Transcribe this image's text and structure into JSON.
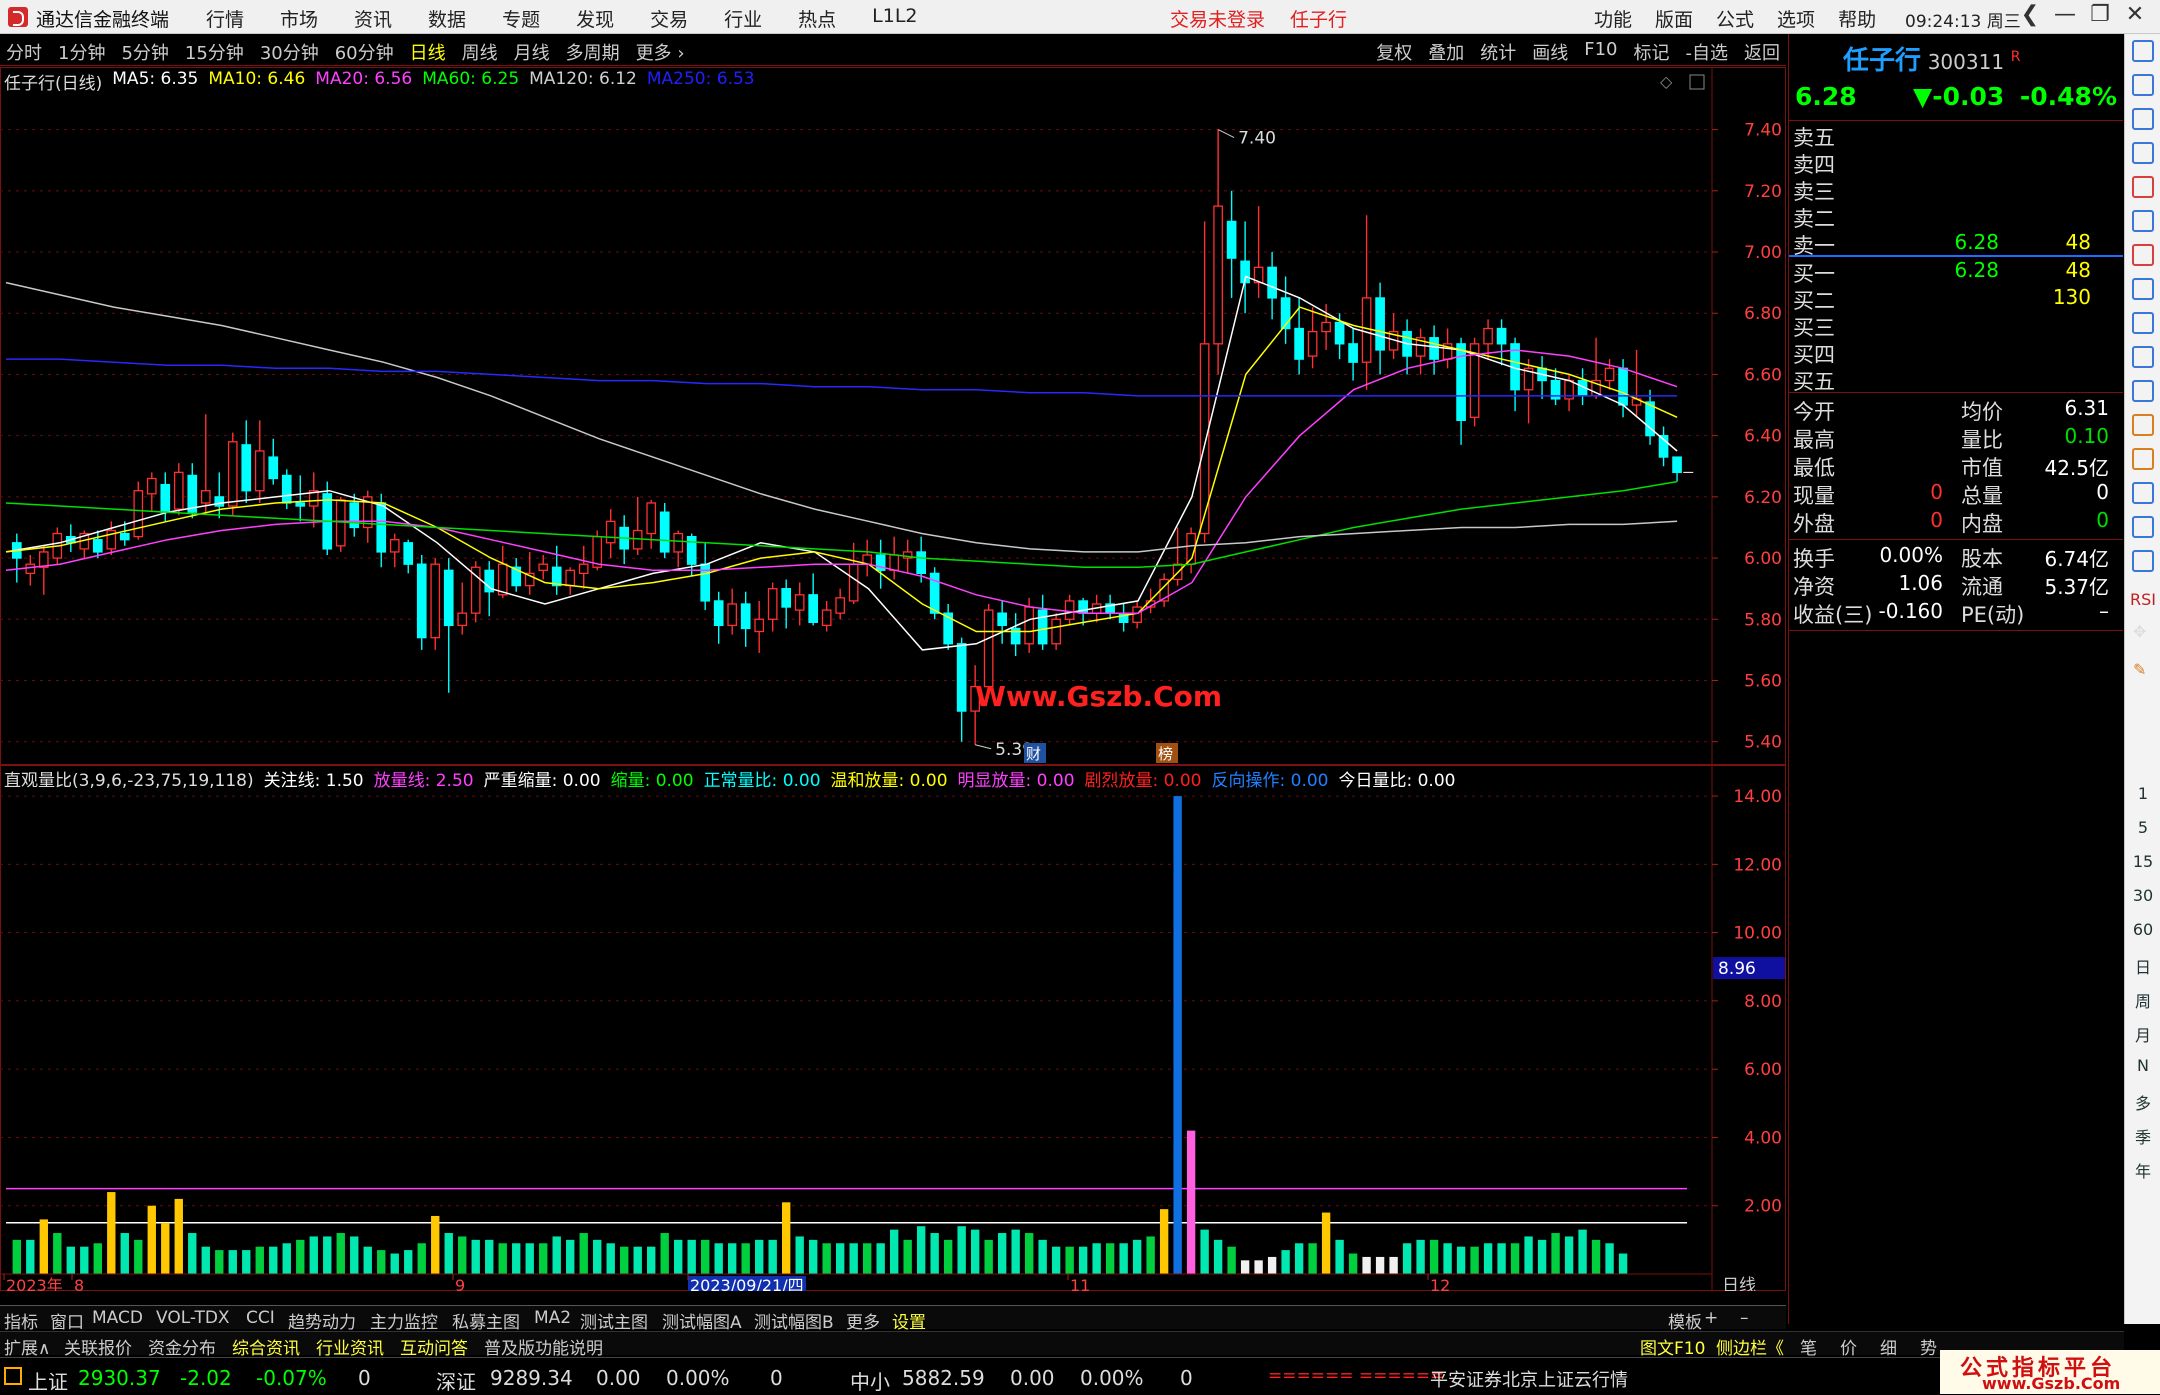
{
  "titlebar": {
    "app_title": "通达信金融终端",
    "menu": [
      "行情",
      "市场",
      "资讯",
      "数据",
      "专题",
      "发现",
      "交易",
      "行业",
      "热点",
      "L1L2"
    ],
    "notice": "交易未登录",
    "stock_name": "任子行",
    "right_menu": [
      "功能",
      "版面",
      "公式",
      "选项",
      "帮助"
    ],
    "time": "09:24:13",
    "weekday": "周三",
    "nav_back": "❮",
    "minimize": "—",
    "restore": "❐",
    "close": "✕"
  },
  "period_bar": {
    "left": [
      "分时",
      "1分钟",
      "5分钟",
      "15分钟",
      "30分钟",
      "60分钟",
      "日线",
      "周线",
      "月线",
      "多周期",
      "更多 ›"
    ],
    "active": "日线",
    "right": [
      "复权",
      "叠加",
      "统计",
      "画线",
      "F10",
      "标记",
      "-自选",
      "返回"
    ]
  },
  "ma_line": {
    "title": "任子行(日线)",
    "items": [
      {
        "label": "MA5: 6.35",
        "color": "#ffffff"
      },
      {
        "label": "MA10: 6.46",
        "color": "#ffff00"
      },
      {
        "label": "MA20: 6.56",
        "color": "#ff40ff"
      },
      {
        "label": "MA60: 6.25",
        "color": "#00ff00"
      },
      {
        "label": "MA120: 6.12",
        "color": "#d0d0d0"
      },
      {
        "label": "MA250: 6.53",
        "color": "#2020ff"
      }
    ]
  },
  "price_axis": [
    "7.40",
    "7.20",
    "7.00",
    "6.80",
    "6.60",
    "6.40",
    "6.20",
    "6.00",
    "5.80",
    "5.60",
    "5.40"
  ],
  "annotations": {
    "high": "7.40",
    "low": "5.39",
    "watermark": "Www.Gszb.Com",
    "tag_cai": "财",
    "tag_bang": "榜"
  },
  "indicator_line": {
    "items": [
      {
        "label": "直观量比(3,9,6,-23,75,19,118)",
        "color": "#dddddd"
      },
      {
        "label": "关注线: 1.50",
        "color": "#ffffff"
      },
      {
        "label": "放量线: 2.50",
        "color": "#ff40ff"
      },
      {
        "label": "严重缩量: 0.00",
        "color": "#ffffff"
      },
      {
        "label": "缩量: 0.00",
        "color": "#00ff00"
      },
      {
        "label": "正常量比: 0.00",
        "color": "#00ffff"
      },
      {
        "label": "温和放量: 0.00",
        "color": "#ffff00"
      },
      {
        "label": "明显放量: 0.00",
        "color": "#ff40ff"
      },
      {
        "label": "剧烈放量: 0.00",
        "color": "#ff2020"
      },
      {
        "label": "反向操作: 0.00",
        "color": "#2080ff"
      },
      {
        "label": "今日量比: 0.00",
        "color": "#ffffff"
      }
    ]
  },
  "indicator_axis": [
    "14.00",
    "12.00",
    "10.00",
    "8.00",
    "6.00",
    "4.00",
    "2.00"
  ],
  "indicator_marker": "8.96",
  "date_axis": {
    "labels": [
      "2023年",
      "8",
      "9",
      "2023/09/21/四",
      "11",
      "12"
    ],
    "period": "日线"
  },
  "chart_data": {
    "type": "candlestick",
    "title": "任子行(日线)",
    "price_range": [
      5.35,
      7.5
    ],
    "ma_values": {
      "MA5": 6.35,
      "MA10": 6.46,
      "MA20": 6.56,
      "MA60": 6.25,
      "MA120": 6.12,
      "MA250": 6.53
    },
    "candles": [
      [
        6.05,
        6.0,
        6.08,
        5.92
      ],
      [
        5.95,
        5.98,
        6.01,
        5.91
      ],
      [
        5.97,
        6.02,
        6.04,
        5.88
      ],
      [
        6.0,
        6.08,
        6.1,
        5.98
      ],
      [
        6.07,
        6.05,
        6.11,
        6.02
      ],
      [
        6.03,
        6.08,
        6.09,
        6.0
      ],
      [
        6.06,
        6.02,
        6.09,
        6.0
      ],
      [
        6.03,
        6.09,
        6.12,
        6.01
      ],
      [
        6.08,
        6.06,
        6.12,
        6.04
      ],
      [
        6.07,
        6.22,
        6.25,
        6.06
      ],
      [
        6.21,
        6.26,
        6.28,
        6.15
      ],
      [
        6.24,
        6.15,
        6.28,
        6.12
      ],
      [
        6.16,
        6.28,
        6.31,
        6.14
      ],
      [
        6.27,
        6.15,
        6.31,
        6.13
      ],
      [
        6.18,
        6.22,
        6.47,
        6.15
      ],
      [
        6.2,
        6.17,
        6.28,
        6.13
      ],
      [
        6.17,
        6.38,
        6.41,
        6.14
      ],
      [
        6.37,
        6.22,
        6.45,
        6.18
      ],
      [
        6.22,
        6.35,
        6.45,
        6.18
      ],
      [
        6.33,
        6.26,
        6.39,
        6.24
      ],
      [
        6.27,
        6.18,
        6.29,
        6.16
      ],
      [
        6.18,
        6.17,
        6.27,
        6.12
      ],
      [
        6.17,
        6.22,
        6.28,
        6.1
      ],
      [
        6.21,
        6.03,
        6.25,
        6.01
      ],
      [
        6.04,
        6.19,
        6.2,
        6.02
      ],
      [
        6.18,
        6.1,
        6.21,
        6.07
      ],
      [
        6.1,
        6.2,
        6.22,
        6.05
      ],
      [
        6.18,
        6.02,
        6.21,
        5.97
      ],
      [
        6.02,
        6.06,
        6.08,
        5.97
      ],
      [
        6.05,
        5.98,
        6.06,
        5.95
      ],
      [
        5.98,
        5.74,
        6.01,
        5.7
      ],
      [
        5.74,
        5.98,
        6.0,
        5.7
      ],
      [
        5.96,
        5.78,
        6.0,
        5.56
      ],
      [
        5.78,
        5.82,
        5.92,
        5.75
      ],
      [
        5.82,
        5.97,
        5.99,
        5.79
      ],
      [
        5.96,
        5.89,
        5.99,
        5.81
      ],
      [
        5.88,
        5.98,
        6.04,
        5.87
      ],
      [
        5.97,
        5.91,
        6.0,
        5.89
      ],
      [
        5.91,
        5.95,
        6.02,
        5.88
      ],
      [
        5.96,
        5.98,
        6.01,
        5.93
      ],
      [
        5.97,
        5.91,
        6.04,
        5.88
      ],
      [
        5.91,
        5.96,
        5.97,
        5.88
      ],
      [
        5.95,
        5.98,
        6.04,
        5.9
      ],
      [
        5.97,
        6.07,
        6.09,
        5.96
      ],
      [
        6.05,
        6.12,
        6.16,
        6.0
      ],
      [
        6.1,
        6.03,
        6.14,
        5.98
      ],
      [
        6.03,
        6.09,
        6.2,
        6.01
      ],
      [
        6.08,
        6.18,
        6.19,
        6.03
      ],
      [
        6.15,
        6.02,
        6.18,
        6.0
      ],
      [
        6.02,
        6.08,
        6.09,
        5.97
      ],
      [
        6.07,
        5.98,
        6.08,
        5.94
      ],
      [
        5.98,
        5.86,
        6.05,
        5.83
      ],
      [
        5.86,
        5.78,
        5.89,
        5.72
      ],
      [
        5.78,
        5.85,
        5.9,
        5.75
      ],
      [
        5.85,
        5.77,
        5.89,
        5.71
      ],
      [
        5.76,
        5.8,
        5.86,
        5.69
      ],
      [
        5.8,
        5.9,
        5.92,
        5.76
      ],
      [
        5.9,
        5.84,
        5.93,
        5.77
      ],
      [
        5.83,
        5.88,
        5.92,
        5.78
      ],
      [
        5.88,
        5.79,
        5.95,
        5.78
      ],
      [
        5.78,
        5.83,
        5.86,
        5.76
      ],
      [
        5.82,
        5.87,
        5.9,
        5.8
      ],
      [
        5.86,
        5.98,
        6.05,
        5.85
      ],
      [
        5.98,
        6.01,
        6.06,
        5.94
      ],
      [
        6.01,
        5.96,
        6.06,
        5.9
      ],
      [
        5.96,
        6.01,
        6.07,
        5.93
      ],
      [
        6.0,
        6.02,
        6.06,
        5.95
      ],
      [
        6.02,
        5.95,
        6.07,
        5.92
      ],
      [
        5.95,
        5.82,
        5.97,
        5.8
      ],
      [
        5.82,
        5.72,
        5.85,
        5.7
      ],
      [
        5.72,
        5.5,
        5.74,
        5.4
      ],
      [
        5.5,
        5.58,
        5.65,
        5.39
      ],
      [
        5.58,
        5.83,
        5.85,
        5.56
      ],
      [
        5.82,
        5.78,
        5.86,
        5.72
      ],
      [
        5.77,
        5.72,
        5.82,
        5.68
      ],
      [
        5.72,
        5.84,
        5.87,
        5.69
      ],
      [
        5.83,
        5.72,
        5.88,
        5.7
      ],
      [
        5.72,
        5.8,
        5.82,
        5.7
      ],
      [
        5.8,
        5.86,
        5.88,
        5.78
      ],
      [
        5.86,
        5.82,
        5.87,
        5.78
      ],
      [
        5.82,
        5.85,
        5.88,
        5.79
      ],
      [
        5.85,
        5.82,
        5.88,
        5.8
      ],
      [
        5.82,
        5.79,
        5.85,
        5.76
      ],
      [
        5.79,
        5.84,
        5.86,
        5.77
      ],
      [
        5.84,
        5.86,
        5.9,
        5.82
      ],
      [
        5.86,
        5.93,
        5.95,
        5.84
      ],
      [
        5.93,
        5.98,
        6.1,
        5.91
      ],
      [
        5.98,
        6.08,
        6.1,
        5.95
      ],
      [
        6.08,
        6.7,
        7.1,
        6.05
      ],
      [
        6.7,
        7.15,
        7.4,
        6.6
      ],
      [
        7.1,
        6.98,
        7.2,
        6.85
      ],
      [
        6.97,
        6.9,
        7.1,
        6.8
      ],
      [
        6.9,
        6.95,
        7.15,
        6.85
      ],
      [
        6.95,
        6.85,
        7.0,
        6.78
      ],
      [
        6.85,
        6.75,
        6.92,
        6.7
      ],
      [
        6.75,
        6.65,
        6.85,
        6.6
      ],
      [
        6.66,
        6.74,
        6.82,
        6.62
      ],
      [
        6.74,
        6.77,
        6.83,
        6.68
      ],
      [
        6.77,
        6.7,
        6.8,
        6.65
      ],
      [
        6.7,
        6.64,
        6.75,
        6.58
      ],
      [
        6.64,
        6.85,
        7.12,
        6.55
      ],
      [
        6.85,
        6.68,
        6.9,
        6.6
      ],
      [
        6.68,
        6.74,
        6.8,
        6.65
      ],
      [
        6.74,
        6.66,
        6.78,
        6.6
      ],
      [
        6.66,
        6.72,
        6.75,
        6.6
      ],
      [
        6.72,
        6.65,
        6.76,
        6.6
      ],
      [
        6.65,
        6.7,
        6.75,
        6.62
      ],
      [
        6.7,
        6.45,
        6.72,
        6.37
      ],
      [
        6.46,
        6.7,
        6.72,
        6.43
      ],
      [
        6.7,
        6.75,
        6.78,
        6.65
      ],
      [
        6.75,
        6.7,
        6.78,
        6.63
      ],
      [
        6.7,
        6.55,
        6.72,
        6.48
      ],
      [
        6.55,
        6.62,
        6.65,
        6.44
      ],
      [
        6.62,
        6.58,
        6.66,
        6.52
      ],
      [
        6.58,
        6.52,
        6.62,
        6.5
      ],
      [
        6.52,
        6.58,
        6.6,
        6.48
      ],
      [
        6.58,
        6.53,
        6.62,
        6.5
      ],
      [
        6.53,
        6.58,
        6.72,
        6.52
      ],
      [
        6.58,
        6.62,
        6.65,
        6.55
      ],
      [
        6.62,
        6.5,
        6.65,
        6.46
      ],
      [
        6.5,
        6.52,
        6.68,
        6.46
      ],
      [
        6.51,
        6.4,
        6.55,
        6.37
      ],
      [
        6.4,
        6.33,
        6.43,
        6.3
      ],
      [
        6.33,
        6.28,
        6.33,
        6.25
      ]
    ],
    "ma_series_sampled": {
      "MA5": [
        6.02,
        6.05,
        6.1,
        6.15,
        6.18,
        6.2,
        6.22,
        6.17,
        6.05,
        5.9,
        5.85,
        5.9,
        5.95,
        5.98,
        6.05,
        6.02,
        5.9,
        5.7,
        5.72,
        5.8,
        5.83,
        5.86,
        6.2,
        6.92,
        6.85,
        6.75,
        6.7,
        6.68,
        6.62,
        6.58,
        6.5,
        6.35
      ],
      "MA10": [
        6.02,
        6.04,
        6.08,
        6.12,
        6.16,
        6.18,
        6.19,
        6.18,
        6.1,
        6.0,
        5.92,
        5.9,
        5.92,
        5.95,
        6.0,
        6.02,
        5.98,
        5.85,
        5.76,
        5.76,
        5.79,
        5.82,
        6.0,
        6.6,
        6.82,
        6.76,
        6.72,
        6.68,
        6.64,
        6.6,
        6.54,
        6.46
      ],
      "MA20": [
        5.96,
        5.98,
        6.02,
        6.06,
        6.09,
        6.11,
        6.12,
        6.12,
        6.1,
        6.06,
        6.02,
        5.98,
        5.96,
        5.96,
        5.97,
        5.98,
        5.98,
        5.94,
        5.88,
        5.84,
        5.82,
        5.82,
        5.92,
        6.2,
        6.4,
        6.55,
        6.62,
        6.66,
        6.68,
        6.66,
        6.62,
        6.56
      ],
      "MA60": [
        6.18,
        6.17,
        6.16,
        6.15,
        6.14,
        6.13,
        6.12,
        6.11,
        6.1,
        6.09,
        6.08,
        6.07,
        6.06,
        6.05,
        6.04,
        6.03,
        6.02,
        6.0,
        5.99,
        5.98,
        5.97,
        5.97,
        5.98,
        6.02,
        6.06,
        6.1,
        6.13,
        6.16,
        6.18,
        6.2,
        6.22,
        6.25
      ],
      "MA120": [
        6.9,
        6.86,
        6.82,
        6.79,
        6.76,
        6.72,
        6.68,
        6.64,
        6.59,
        6.53,
        6.46,
        6.39,
        6.33,
        6.27,
        6.21,
        6.16,
        6.12,
        6.08,
        6.05,
        6.03,
        6.02,
        6.02,
        6.04,
        6.05,
        6.07,
        6.08,
        6.09,
        6.1,
        6.1,
        6.11,
        6.11,
        6.12
      ],
      "MA250": [
        6.65,
        6.65,
        6.64,
        6.63,
        6.63,
        6.62,
        6.62,
        6.61,
        6.61,
        6.6,
        6.59,
        6.58,
        6.58,
        6.57,
        6.57,
        6.56,
        6.56,
        6.55,
        6.55,
        6.54,
        6.54,
        6.53,
        6.53,
        6.53,
        6.53,
        6.53,
        6.53,
        6.53,
        6.53,
        6.53,
        6.53,
        6.53
      ]
    },
    "volume_ratio": {
      "focus_line": 1.5,
      "heavy_line": 2.5,
      "ylim": [
        0,
        14.5
      ],
      "values": [
        1.0,
        1.0,
        1.6,
        1.2,
        0.8,
        0.8,
        0.9,
        2.4,
        1.2,
        1.0,
        2.0,
        1.5,
        2.2,
        1.2,
        0.8,
        0.7,
        0.7,
        0.7,
        0.8,
        0.8,
        0.9,
        1.0,
        1.1,
        1.1,
        1.2,
        1.1,
        0.8,
        0.7,
        0.6,
        0.7,
        0.9,
        1.7,
        1.2,
        1.1,
        1.0,
        1.0,
        0.9,
        0.9,
        0.9,
        0.9,
        1.1,
        1.0,
        1.2,
        1.0,
        0.9,
        0.8,
        0.8,
        0.8,
        1.2,
        1.0,
        1.0,
        1.0,
        0.9,
        0.9,
        0.9,
        1.0,
        1.0,
        2.1,
        1.1,
        1.0,
        0.9,
        0.9,
        0.9,
        0.9,
        0.9,
        1.3,
        1.0,
        1.4,
        1.2,
        1.0,
        1.4,
        1.3,
        1.0,
        1.2,
        1.3,
        1.2,
        1.0,
        0.8,
        0.8,
        0.8,
        0.9,
        0.9,
        0.9,
        1.0,
        1.1,
        1.9,
        14.0,
        4.2,
        1.3,
        1.0,
        0.8,
        0.4,
        0.4,
        0.5,
        0.7,
        0.9,
        0.9,
        1.8,
        1.0,
        0.6,
        0.5,
        0.5,
        0.5,
        0.9,
        1.0,
        1.0,
        0.9,
        0.8,
        0.8,
        0.9,
        0.9,
        0.9,
        1.1,
        1.0,
        1.2,
        1.1,
        1.3,
        1.0,
        0.9,
        0.6
      ],
      "colors": {
        "normal": "#00e8b0",
        "green": "#00d040",
        "yellow": "#ffc800",
        "blue": "#1070e0",
        "pink": "#ff60e0",
        "white": "#f0f0f0"
      }
    }
  },
  "quote": {
    "name": "任子行",
    "code": "300311",
    "r_mark": "R",
    "price": "6.28",
    "change": "▼-0.03",
    "change_pct": "-0.48%",
    "sell": [
      {
        "label": "卖五",
        "price": "",
        "vol": ""
      },
      {
        "label": "卖四",
        "price": "",
        "vol": ""
      },
      {
        "label": "卖三",
        "price": "",
        "vol": ""
      },
      {
        "label": "卖二",
        "price": "",
        "vol": ""
      },
      {
        "label": "卖一",
        "price": "6.28",
        "vol": "48"
      }
    ],
    "buy": [
      {
        "label": "买一",
        "price": "6.28",
        "vol": "48"
      },
      {
        "label": "买二",
        "price": "",
        "vol": "130"
      },
      {
        "label": "买三",
        "price": "",
        "vol": ""
      },
      {
        "label": "买四",
        "price": "",
        "vol": ""
      },
      {
        "label": "买五",
        "price": "",
        "vol": ""
      }
    ],
    "stats1": [
      {
        "l1": "今开",
        "v1": "",
        "l2": "均价",
        "v2": "6.31",
        "c2": "#ffffff"
      },
      {
        "l1": "最高",
        "v1": "",
        "l2": "量比",
        "v2": "0.10",
        "c2": "#00e000"
      },
      {
        "l1": "最低",
        "v1": "",
        "l2": "市值",
        "v2": "42.5亿",
        "c2": "#ffffff"
      },
      {
        "l1": "现量",
        "v1": "0",
        "l2": "总量",
        "v2": "0",
        "c1": "#ff3030",
        "c2": "#ffffff"
      },
      {
        "l1": "外盘",
        "v1": "0",
        "l2": "内盘",
        "v2": "0",
        "c1": "#ff3030",
        "c2": "#00e000"
      }
    ],
    "stats2": [
      {
        "l1": "换手",
        "v1": "0.00%",
        "l2": "股本",
        "v2": "6.74亿"
      },
      {
        "l1": "净资",
        "v1": "1.06",
        "l2": "流通",
        "v2": "5.37亿"
      },
      {
        "l1": "收益(三)",
        "v1": "-0.160",
        "l2": "PE(动)",
        "v2": "–"
      }
    ]
  },
  "sidebar": {
    "labels": [
      "RSI",
      "1",
      "5",
      "15",
      "30",
      "60",
      "日",
      "周",
      "月",
      "N",
      "多",
      "季",
      "年"
    ]
  },
  "bottom_tabs": {
    "row1": [
      "指标",
      "窗口",
      "MACD",
      "VOL-TDX",
      "CCI",
      "趋势动力",
      "主力监控",
      "私募主图",
      "MA2",
      "测试主图",
      "测试幅图A",
      "测试幅图B",
      "更多",
      "设置"
    ],
    "row1_right": [
      "模板",
      "+",
      "–"
    ],
    "row2": [
      "扩展∧",
      "关联报价",
      "资金分布",
      "综合资讯",
      "行业资讯",
      "互动问答",
      "普及版功能说明"
    ],
    "row2_right": [
      "图文F10",
      "侧边栏《",
      "笔",
      "价",
      "细",
      "势"
    ]
  },
  "status": {
    "sh_label": "上证",
    "sh_value": "2930.37",
    "sh_change": "-2.02",
    "sh_pct": "-0.07%",
    "sh_vol": "0",
    "sz_label": "深证",
    "sz_value": "9289.34",
    "sz_change": "0.00",
    "sz_pct": "0.00%",
    "sz_vol": "0",
    "zx_label": "中小",
    "zx_value": "5882.59",
    "zx_change": "0.00",
    "zx_pct": "0.00%",
    "zx_vol": "0",
    "bars": "====== ======",
    "server": "平安证券北京上证云行情",
    "brand_cn": "公式指标平台",
    "brand_url": "www.Gszb.Com"
  }
}
